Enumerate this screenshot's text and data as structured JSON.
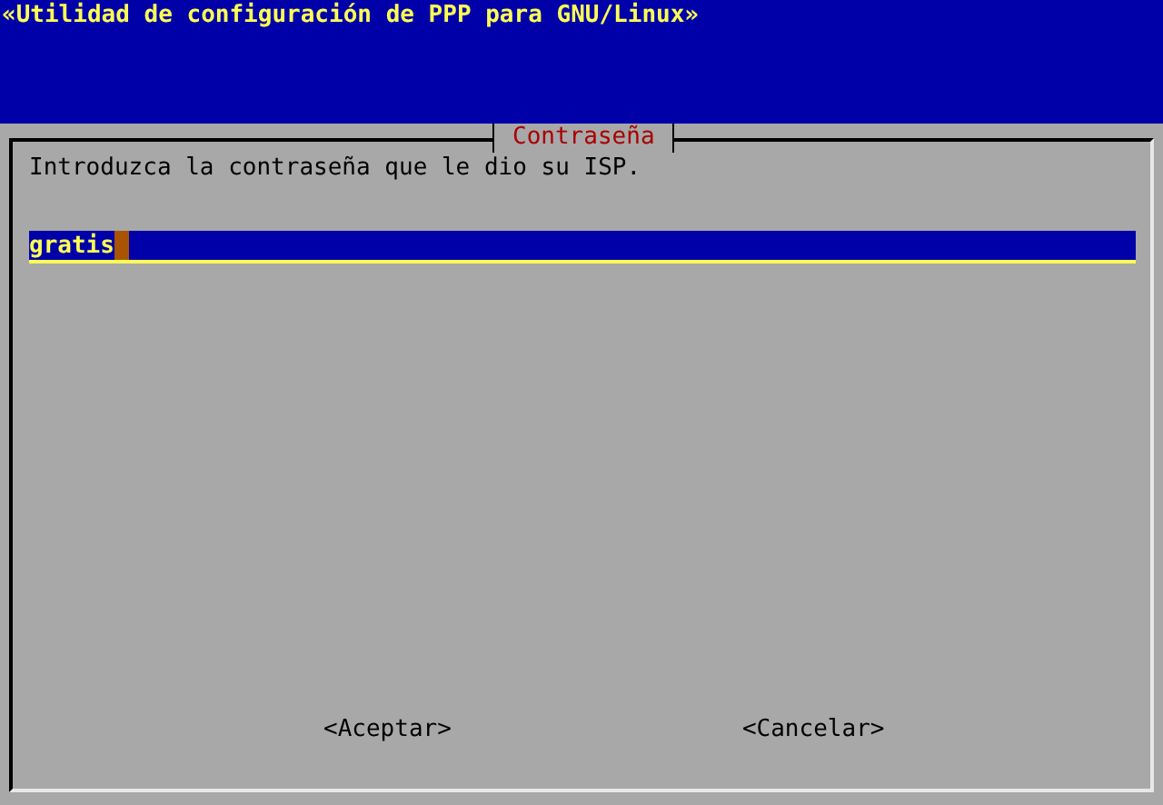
{
  "header": {
    "title": "«Utilidad de configuración de PPP para GNU/Linux»"
  },
  "dialog": {
    "title": "Contraseña",
    "prompt": "Introduzca la contraseña que le dio su ISP.",
    "input": {
      "value": "gratis"
    },
    "buttons": [
      {
        "label": "<Aceptar>"
      },
      {
        "label": "<Cancelar>"
      }
    ]
  }
}
